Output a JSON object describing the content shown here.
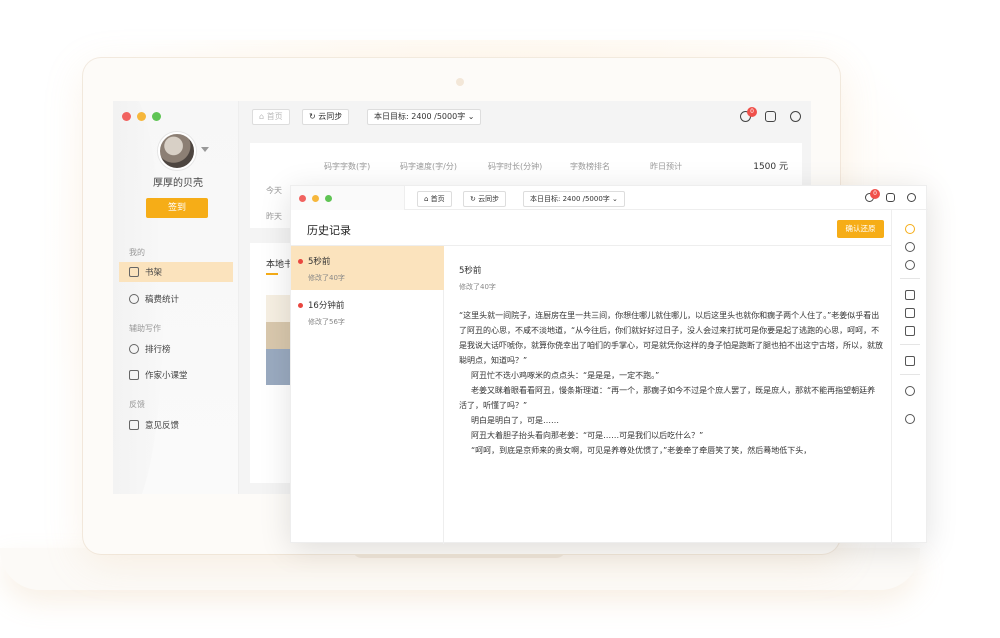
{
  "back_window": {
    "user": {
      "name": "厚厚的贝壳",
      "signin_label": "签到"
    },
    "sidebar": {
      "sections": [
        {
          "label": "我的"
        },
        {
          "label": "辅助写作"
        },
        {
          "label": "反馈"
        }
      ],
      "items": [
        {
          "label": "书架",
          "icon": "bookshelf-icon"
        },
        {
          "label": "稿费统计",
          "icon": "chart-icon"
        },
        {
          "label": "排行榜",
          "icon": "trophy-icon"
        },
        {
          "label": "作家小课堂",
          "icon": "classroom-icon"
        },
        {
          "label": "意见反馈",
          "icon": "edit-icon"
        }
      ]
    },
    "toolbar": {
      "home_label": "首页",
      "sync_label": "云同步",
      "goal_label": "本日目标: 2400 /5000字",
      "notification_count": "0"
    },
    "stats": {
      "headers": [
        "码字字数(字)",
        "码字速度(字/分)",
        "码字时长(分钟)",
        "字数榜排名",
        "昨日预计"
      ],
      "income": "1500 元",
      "rows": [
        "今天",
        "昨天"
      ]
    },
    "local_tab_label": "本地书"
  },
  "front_window": {
    "toolbar": {
      "home_label": "首页",
      "sync_label": "云同步",
      "goal_label": "本日目标: 2400 /5000字",
      "notification_count": "0"
    },
    "title": "历史记录",
    "confirm_label": "确认还原",
    "history": [
      {
        "time": "5秒前",
        "change": "修改了40字"
      },
      {
        "time": "16分钟前",
        "change": "修改了56字"
      }
    ],
    "content": {
      "time": "5秒前",
      "change": "修改了40字",
      "paragraphs": [
        "“这里头就一间院子，连厨房在里一共三间，你想住哪儿就住哪儿，以后这里头也就你和瘸子两个人住了。”老姜似乎看出了阿丑的心思，不咸不淡地道，“从今往后，你们就好好过日子，没人会过来打扰可是你要是起了逃跑的心思，呵呵，不是我说大话吓唬你，就算你侥幸出了咱们的手掌心，可是就凭你这样的身子怕是跑断了腿也拍不出这宁古塔，所以，就放聪明点，知道吗？”",
        "阿丑忙不迭小鸡啄米的点点头：“是是是，一定不跑。”",
        "老姜又眯着眼看看阿丑，慢条斯理道：“再一个，那瘸子如今不过是个庶人罢了，既是庶人，那就不能再指望朝廷养活了，听懂了吗？”",
        "明白是明白了，可是……",
        "阿丑大着胆子抬头看向那老姜：“可是……可是我们以后吃什么？”",
        "“呵呵，到底是京师来的贵女啊，可见是养尊处优惯了，”老姜牵了牵唇笑了笑，然后蓦地低下头，"
      ]
    },
    "rail_icons": [
      "clock-icon",
      "swap-icon",
      "font-icon",
      "list-icon",
      "note-icon",
      "copy-icon",
      "calendar-icon",
      "info-icon",
      "quote-icon"
    ]
  },
  "colors": {
    "accent": "#f6ad17",
    "active_bg": "#fbe3bd",
    "dot_red": "#e9463f"
  }
}
